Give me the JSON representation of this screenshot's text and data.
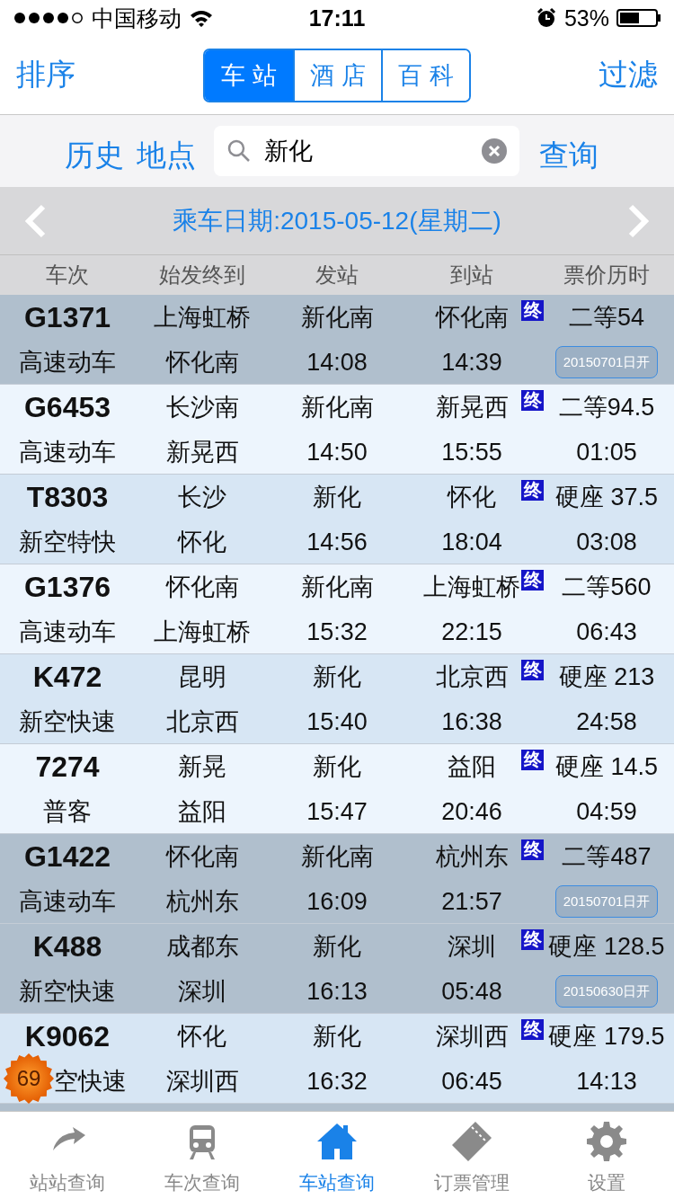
{
  "status_bar": {
    "carrier": "中国移动",
    "time": "17:11",
    "battery": "53%"
  },
  "nav": {
    "left": "排序",
    "right": "过滤",
    "segments": [
      {
        "label": "车站",
        "selected": true
      },
      {
        "label": "酒店",
        "selected": false
      },
      {
        "label": "百科",
        "selected": false
      }
    ]
  },
  "search": {
    "buttons": [
      "历史",
      "地点"
    ],
    "value": "新化",
    "submit": "查询"
  },
  "date_bar": {
    "label": "乘车日期:2015-05-12(星期二)"
  },
  "table": {
    "columns": [
      "车次",
      "始发终到",
      "发站",
      "到站",
      "票价历时"
    ],
    "rows": [
      {
        "kind": "presale",
        "train": "G1371",
        "type": "高速动车",
        "origin": "上海虹桥",
        "destination": "怀化南",
        "from": "新化南",
        "depart": "14:08",
        "to": "怀化南",
        "arrive": "14:39",
        "mark": "终",
        "price": "二等54",
        "note": "20150701日开"
      },
      {
        "kind": "normal",
        "train": "G6453",
        "type": "高速动车",
        "origin": "长沙南",
        "destination": "新晃西",
        "from": "新化南",
        "depart": "14:50",
        "to": "新晃西",
        "arrive": "15:55",
        "mark": "终",
        "price": "二等94.5",
        "duration": "01:05"
      },
      {
        "kind": "normal",
        "train": "T8303",
        "type": "新空特快",
        "origin": "长沙",
        "destination": "怀化",
        "from": "新化",
        "depart": "14:56",
        "to": "怀化",
        "arrive": "18:04",
        "mark": "终",
        "price": "硬座 37.5",
        "duration": "03:08"
      },
      {
        "kind": "normal",
        "train": "G1376",
        "type": "高速动车",
        "origin": "怀化南",
        "destination": "上海虹桥",
        "from": "新化南",
        "depart": "15:32",
        "to": "上海虹桥",
        "arrive": "22:15",
        "mark": "终",
        "price": "二等560",
        "duration": "06:43"
      },
      {
        "kind": "normal",
        "train": "K472",
        "type": "新空快速",
        "origin": "昆明",
        "destination": "北京西",
        "from": "新化",
        "depart": "15:40",
        "to": "北京西",
        "arrive": "16:38",
        "mark": "终",
        "price": "硬座 213",
        "duration": "24:58"
      },
      {
        "kind": "normal",
        "train": "7274",
        "type": "普客",
        "origin": "新晃",
        "destination": "益阳",
        "from": "新化",
        "depart": "15:47",
        "to": "益阳",
        "arrive": "20:46",
        "mark": "终",
        "price": "硬座 14.5",
        "duration": "04:59"
      },
      {
        "kind": "presale",
        "train": "G1422",
        "type": "高速动车",
        "origin": "怀化南",
        "destination": "杭州东",
        "from": "新化南",
        "depart": "16:09",
        "to": "杭州东",
        "arrive": "21:57",
        "mark": "终",
        "price": "二等487",
        "note": "20150701日开"
      },
      {
        "kind": "presale",
        "train": "K488",
        "type": "新空快速",
        "origin": "成都东",
        "destination": "深圳",
        "from": "新化",
        "depart": "16:13",
        "to": "深圳",
        "arrive": "05:48",
        "mark": "终",
        "price": "硬座 128.5",
        "note": "20150630日开"
      },
      {
        "kind": "normal",
        "train": "K9062",
        "type": "空快速",
        "origin": "怀化",
        "destination": "深圳西",
        "from": "新化",
        "depart": "16:32",
        "to": "深圳西",
        "arrive": "06:45",
        "mark": "终",
        "price": "硬座 179.5",
        "duration": "14:13"
      }
    ]
  },
  "floating_badge": "69",
  "tab_bar": [
    {
      "label": "站站查询",
      "selected": false
    },
    {
      "label": "车次查询",
      "selected": false
    },
    {
      "label": "车站查询",
      "selected": true
    },
    {
      "label": "订票管理",
      "selected": false
    },
    {
      "label": "设置",
      "selected": false
    }
  ]
}
